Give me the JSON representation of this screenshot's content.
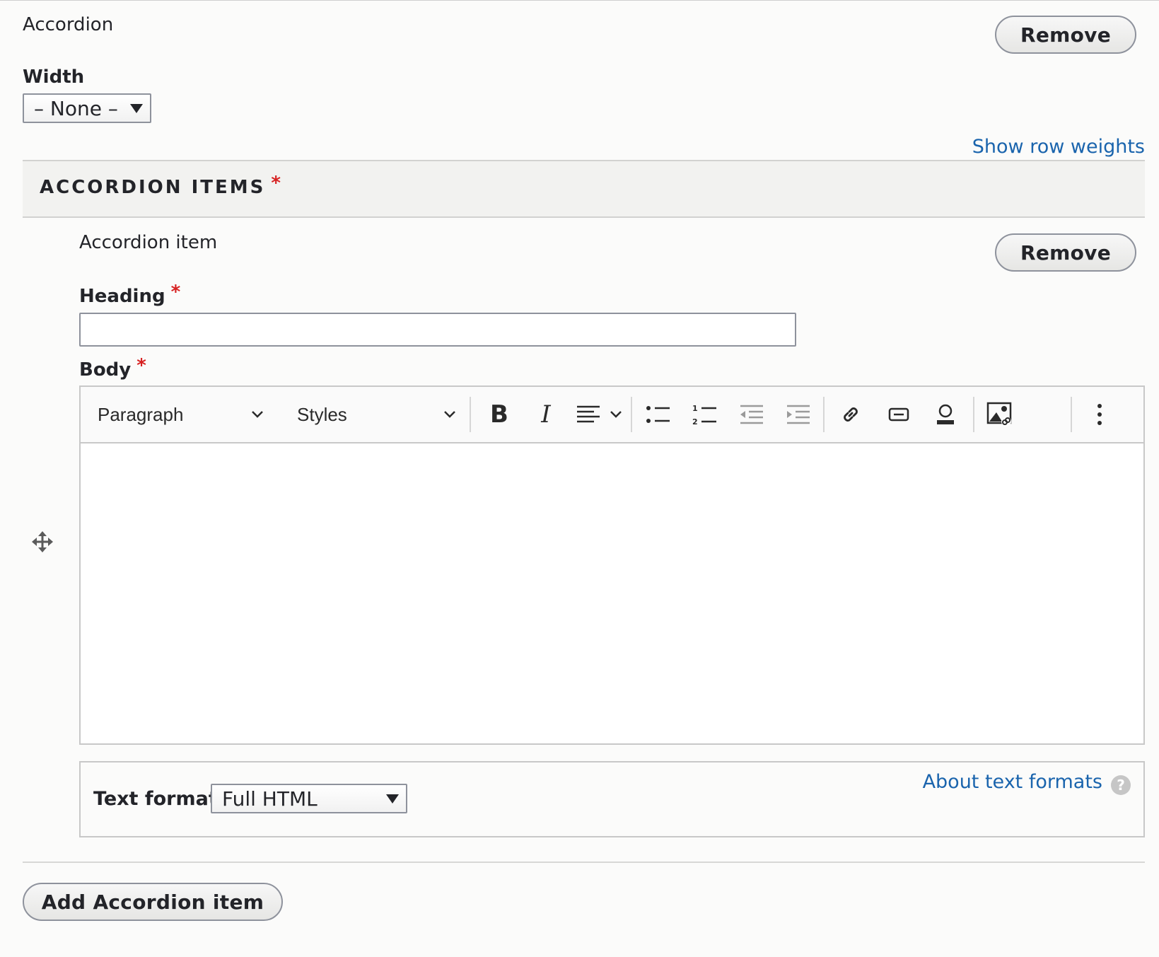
{
  "accordion": {
    "label": "Accordion",
    "remove_label": "Remove",
    "width_label": "Width",
    "width_value": "– None –",
    "show_row_weights": "Show row weights"
  },
  "items_section": {
    "title": "ACCORDION ITEMS",
    "required_mark": "*"
  },
  "item": {
    "label": "Accordion item",
    "remove_label": "Remove",
    "heading_label": "Heading",
    "heading_required": "*",
    "heading_value": "",
    "body_label": "Body",
    "body_required": "*"
  },
  "toolbar": {
    "paragraph": "Paragraph",
    "styles": "Styles",
    "icons": [
      "bold-icon",
      "italic-icon",
      "align-icon",
      "bulleted-list-icon",
      "numbered-list-icon",
      "outdent-icon",
      "indent-icon",
      "link-icon",
      "embed-icon",
      "media-icon",
      "image-link-icon",
      "more-icon"
    ]
  },
  "text_format": {
    "label": "Text format",
    "value": "Full HTML",
    "about_link": "About text formats",
    "help_glyph": "?"
  },
  "add_item_label": "Add Accordion item",
  "colors": {
    "link": "#1a64ad",
    "required": "#d72222",
    "text": "#232429"
  }
}
